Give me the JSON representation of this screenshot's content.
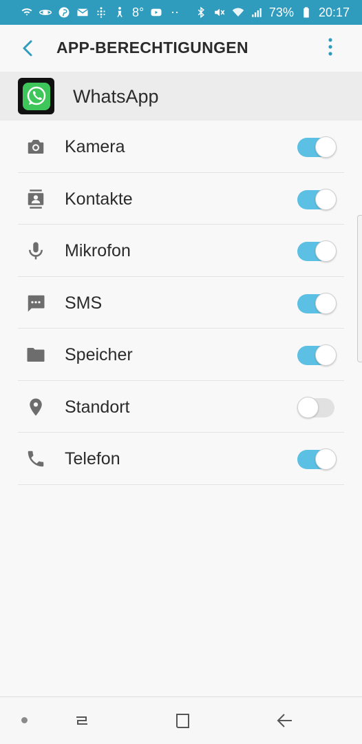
{
  "status_bar": {
    "temperature": "8°",
    "battery": "73%",
    "time": "20:17",
    "background": "#2f9bbd"
  },
  "header": {
    "title": "APP-BERECHTIGUNGEN"
  },
  "app": {
    "name": "WhatsApp"
  },
  "permissions": [
    {
      "label": "Kamera",
      "icon": "camera-icon",
      "enabled": true
    },
    {
      "label": "Kontakte",
      "icon": "contacts-icon",
      "enabled": true
    },
    {
      "label": "Mikrofon",
      "icon": "microphone-icon",
      "enabled": true
    },
    {
      "label": "SMS",
      "icon": "sms-icon",
      "enabled": true
    },
    {
      "label": "Speicher",
      "icon": "folder-icon",
      "enabled": true
    },
    {
      "label": "Standort",
      "icon": "location-icon",
      "enabled": false
    },
    {
      "label": "Telefon",
      "icon": "phone-icon",
      "enabled": true
    }
  ],
  "colors": {
    "accent": "#2f9bbd",
    "toggle_on": "#5bc0e3",
    "toggle_off": "#e1e1e1"
  }
}
